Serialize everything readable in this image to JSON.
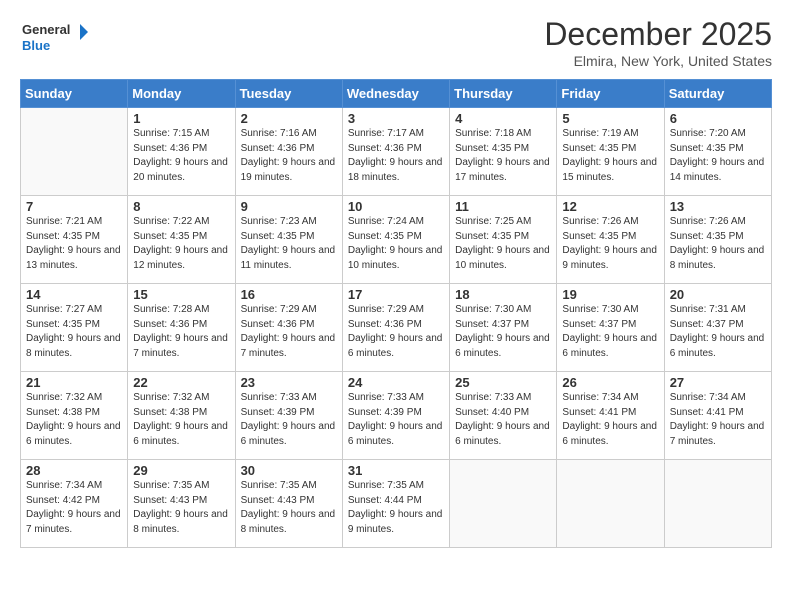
{
  "header": {
    "logo_line1": "General",
    "logo_line2": "Blue",
    "title": "December 2025",
    "location": "Elmira, New York, United States"
  },
  "weekdays": [
    "Sunday",
    "Monday",
    "Tuesday",
    "Wednesday",
    "Thursday",
    "Friday",
    "Saturday"
  ],
  "weeks": [
    [
      {
        "day": "",
        "empty": true
      },
      {
        "day": "1",
        "rise": "7:15 AM",
        "set": "4:36 PM",
        "hours": "9 hours and 20 minutes."
      },
      {
        "day": "2",
        "rise": "7:16 AM",
        "set": "4:36 PM",
        "hours": "9 hours and 19 minutes."
      },
      {
        "day": "3",
        "rise": "7:17 AM",
        "set": "4:36 PM",
        "hours": "9 hours and 18 minutes."
      },
      {
        "day": "4",
        "rise": "7:18 AM",
        "set": "4:35 PM",
        "hours": "9 hours and 17 minutes."
      },
      {
        "day": "5",
        "rise": "7:19 AM",
        "set": "4:35 PM",
        "hours": "9 hours and 15 minutes."
      },
      {
        "day": "6",
        "rise": "7:20 AM",
        "set": "4:35 PM",
        "hours": "9 hours and 14 minutes."
      }
    ],
    [
      {
        "day": "7",
        "rise": "7:21 AM",
        "set": "4:35 PM",
        "hours": "9 hours and 13 minutes."
      },
      {
        "day": "8",
        "rise": "7:22 AM",
        "set": "4:35 PM",
        "hours": "9 hours and 12 minutes."
      },
      {
        "day": "9",
        "rise": "7:23 AM",
        "set": "4:35 PM",
        "hours": "9 hours and 11 minutes."
      },
      {
        "day": "10",
        "rise": "7:24 AM",
        "set": "4:35 PM",
        "hours": "9 hours and 10 minutes."
      },
      {
        "day": "11",
        "rise": "7:25 AM",
        "set": "4:35 PM",
        "hours": "9 hours and 10 minutes."
      },
      {
        "day": "12",
        "rise": "7:26 AM",
        "set": "4:35 PM",
        "hours": "9 hours and 9 minutes."
      },
      {
        "day": "13",
        "rise": "7:26 AM",
        "set": "4:35 PM",
        "hours": "9 hours and 8 minutes."
      }
    ],
    [
      {
        "day": "14",
        "rise": "7:27 AM",
        "set": "4:35 PM",
        "hours": "9 hours and 8 minutes."
      },
      {
        "day": "15",
        "rise": "7:28 AM",
        "set": "4:36 PM",
        "hours": "9 hours and 7 minutes."
      },
      {
        "day": "16",
        "rise": "7:29 AM",
        "set": "4:36 PM",
        "hours": "9 hours and 7 minutes."
      },
      {
        "day": "17",
        "rise": "7:29 AM",
        "set": "4:36 PM",
        "hours": "9 hours and 6 minutes."
      },
      {
        "day": "18",
        "rise": "7:30 AM",
        "set": "4:37 PM",
        "hours": "9 hours and 6 minutes."
      },
      {
        "day": "19",
        "rise": "7:30 AM",
        "set": "4:37 PM",
        "hours": "9 hours and 6 minutes."
      },
      {
        "day": "20",
        "rise": "7:31 AM",
        "set": "4:37 PM",
        "hours": "9 hours and 6 minutes."
      }
    ],
    [
      {
        "day": "21",
        "rise": "7:32 AM",
        "set": "4:38 PM",
        "hours": "9 hours and 6 minutes."
      },
      {
        "day": "22",
        "rise": "7:32 AM",
        "set": "4:38 PM",
        "hours": "9 hours and 6 minutes."
      },
      {
        "day": "23",
        "rise": "7:33 AM",
        "set": "4:39 PM",
        "hours": "9 hours and 6 minutes."
      },
      {
        "day": "24",
        "rise": "7:33 AM",
        "set": "4:39 PM",
        "hours": "9 hours and 6 minutes."
      },
      {
        "day": "25",
        "rise": "7:33 AM",
        "set": "4:40 PM",
        "hours": "9 hours and 6 minutes."
      },
      {
        "day": "26",
        "rise": "7:34 AM",
        "set": "4:41 PM",
        "hours": "9 hours and 6 minutes."
      },
      {
        "day": "27",
        "rise": "7:34 AM",
        "set": "4:41 PM",
        "hours": "9 hours and 7 minutes."
      }
    ],
    [
      {
        "day": "28",
        "rise": "7:34 AM",
        "set": "4:42 PM",
        "hours": "9 hours and 7 minutes."
      },
      {
        "day": "29",
        "rise": "7:35 AM",
        "set": "4:43 PM",
        "hours": "9 hours and 8 minutes."
      },
      {
        "day": "30",
        "rise": "7:35 AM",
        "set": "4:43 PM",
        "hours": "9 hours and 8 minutes."
      },
      {
        "day": "31",
        "rise": "7:35 AM",
        "set": "4:44 PM",
        "hours": "9 hours and 9 minutes."
      },
      {
        "day": "",
        "empty": true
      },
      {
        "day": "",
        "empty": true
      },
      {
        "day": "",
        "empty": true
      }
    ]
  ]
}
